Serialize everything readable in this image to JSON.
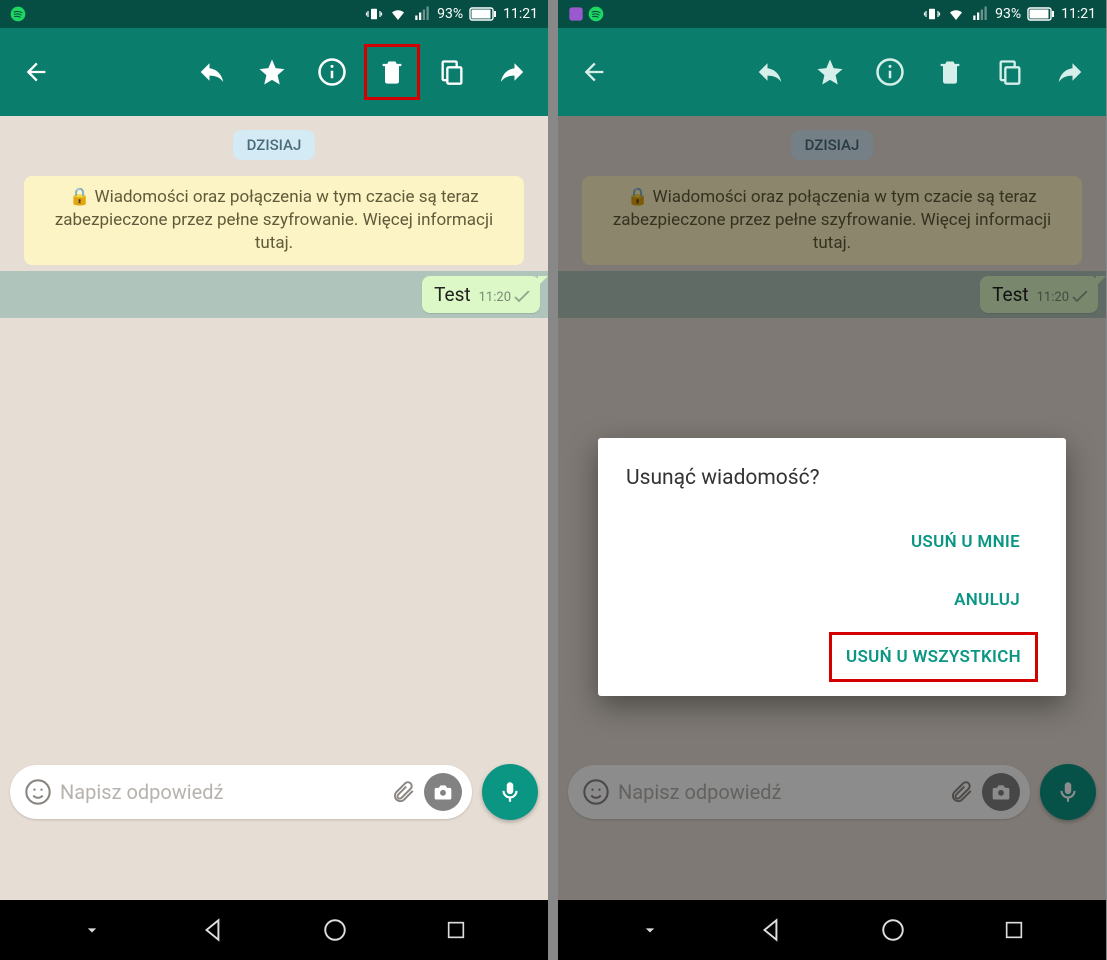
{
  "status": {
    "battery_pct": "93%",
    "time": "11:21"
  },
  "chat": {
    "date_label": "DZISIAJ",
    "encryption_text": "Wiadomości oraz połączenia w tym czacie są teraz zabezpieczone przez pełne szyfrowanie. Więcej informacji tutaj.",
    "message": {
      "text": "Test",
      "time": "11:20"
    },
    "input_placeholder": "Napisz odpowiedź"
  },
  "dialog": {
    "title": "Usunąć wiadomość?",
    "delete_for_me": "USUŃ U MNIE",
    "cancel": "ANULUJ",
    "delete_for_all": "USUŃ U WSZYSTKICH"
  }
}
